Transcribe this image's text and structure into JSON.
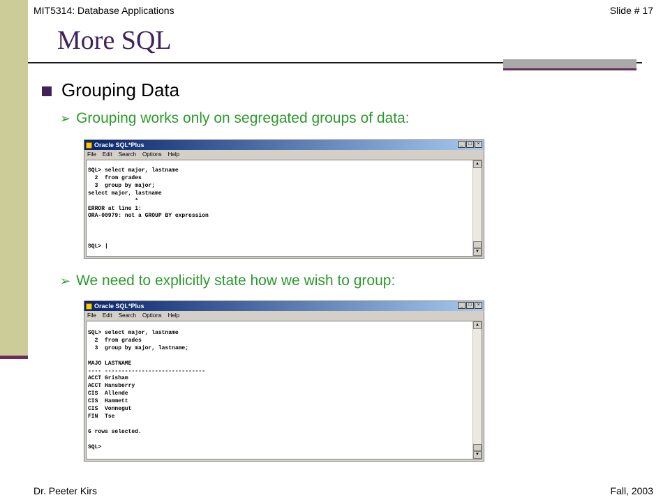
{
  "header": {
    "course": "MIT5314: Database Applications",
    "slide": "Slide # 17"
  },
  "title": "More SQL",
  "bullets": {
    "main": "Grouping Data",
    "sub1": "Grouping works only on segregated groups of data:",
    "sub2": "We need to explicitly state how we wish to group:"
  },
  "window1": {
    "title": "Oracle SQL*Plus",
    "menu": [
      "File",
      "Edit",
      "Search",
      "Options",
      "Help"
    ],
    "buttons": {
      "minimize": "_",
      "maximize": "□",
      "close": "×"
    },
    "console": "SQL> select major, lastname\n  2  from grades\n  3  group by major;\nselect major, lastname\n              *\nERROR at line 1:\nORA-00979: not a GROUP BY expression\n\n\n\nSQL> |"
  },
  "window2": {
    "title": "Oracle SQL*Plus",
    "menu": [
      "File",
      "Edit",
      "Search",
      "Options",
      "Help"
    ],
    "buttons": {
      "minimize": "_",
      "maximize": "□",
      "close": "×"
    },
    "console": "SQL> select major, lastname\n  2  from grades\n  3  group by major, lastname;\n\nMAJO LASTNAME\n---- ------------------------------\nACCT Grisham\nACCT Hansberry\nCIS  Allende\nCIS  Hammett\nCIS  Vonnegut\nFIN  Tse\n\n6 rows selected.\n\nSQL>"
  },
  "scroll": {
    "up": "▲",
    "down": "▼"
  },
  "footer": {
    "author": "Dr. Peeter Kirs",
    "term": "Fall, 2003"
  },
  "colors": {
    "accent_purple": "#40215a",
    "bullet_green": "#2b9a2b",
    "left_bar": "#cccc99",
    "maroon": "#6b2c5c"
  }
}
